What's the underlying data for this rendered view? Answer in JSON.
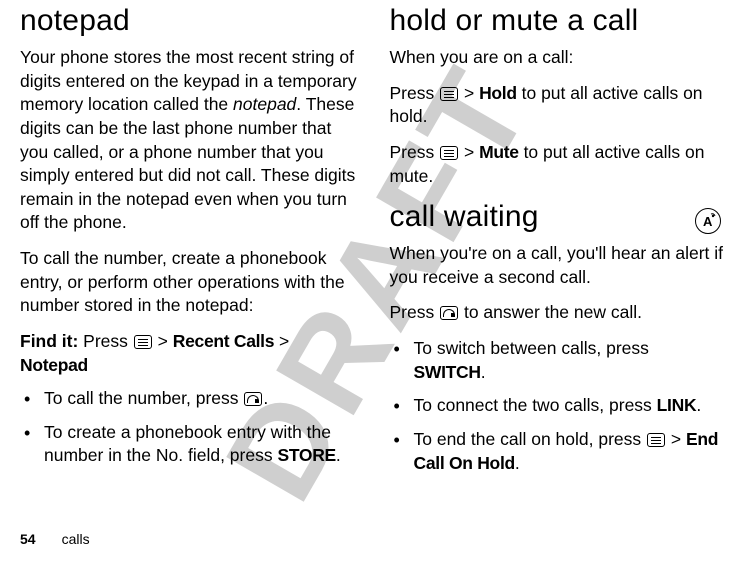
{
  "watermark": "DRAFT",
  "page_number": "54",
  "footer_section": "calls",
  "left": {
    "heading": "notepad",
    "p1_a": "Your phone stores the most recent string of digits entered on the keypad in a temporary memory location called the ",
    "p1_em": "notepad",
    "p1_b": ". These digits can be the last phone number that you called, or a phone number that you simply entered but did not call. These digits remain in the notepad even when you turn off the phone.",
    "p2": "To call the number, create a phonebook entry, or perform other operations with the number stored in the notepad:",
    "findit_lead": "Find it:",
    "findit_press": " Press ",
    "findit_gt1": " > ",
    "findit_m1": "Recent Calls",
    "findit_gt2": " > ",
    "findit_m2": "Notepad",
    "b1_a": "To call the number, press ",
    "b1_b": ".",
    "b2_a": "To create a phonebook entry with the number in the No. field, press ",
    "b2_store": "STORE",
    "b2_b": "."
  },
  "right": {
    "heading1": "hold or mute a call",
    "p1": "When you are on a call:",
    "p2_a": "Press ",
    "p2_gt": " > ",
    "p2_hold": "Hold",
    "p2_b": " to put all active calls on hold.",
    "p3_a": "Press ",
    "p3_gt": " > ",
    "p3_mute": "Mute",
    "p3_b": " to put all active calls on mute.",
    "heading2": "call waiting",
    "p4": "When you're on a call, you'll hear an alert if you receive a second call.",
    "p5_a": "Press ",
    "p5_b": " to answer the new call.",
    "b1_a": "To switch between calls, press ",
    "b1_switch": "SWITCH",
    "b1_b": ".",
    "b2_a": "To connect the two calls, press ",
    "b2_link": "LINK",
    "b2_b": ".",
    "b3_a": "To end the call on hold, press ",
    "b3_gt": " > ",
    "b3_end": "End Call On Hold",
    "b3_b": "."
  }
}
